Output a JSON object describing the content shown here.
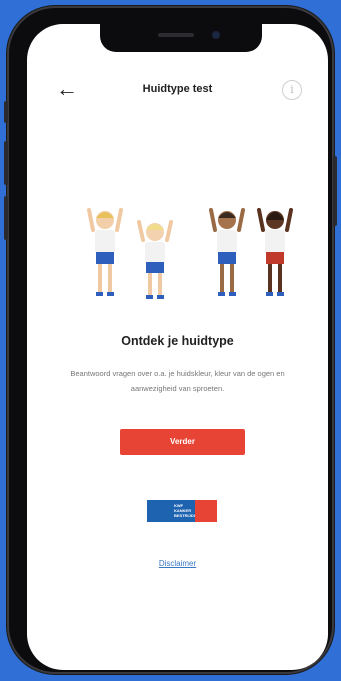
{
  "header": {
    "title": "Huidtype test",
    "back_icon": "←",
    "info_icon": "i"
  },
  "intro": {
    "heading": "Ontdek je huidtype",
    "description": "Beantwoord vragen over o.a. je huidskleur, kleur van de ogen en aanwezigheid van sproeten."
  },
  "actions": {
    "next_label": "Verder",
    "disclaimer_label": "Disclaimer"
  },
  "logo": {
    "text": "KWF\nKANKER\nBESTRIJDING"
  },
  "colors": {
    "accent": "#e84435",
    "link": "#3a78c4",
    "frame_bg": "#2f6fd6"
  }
}
